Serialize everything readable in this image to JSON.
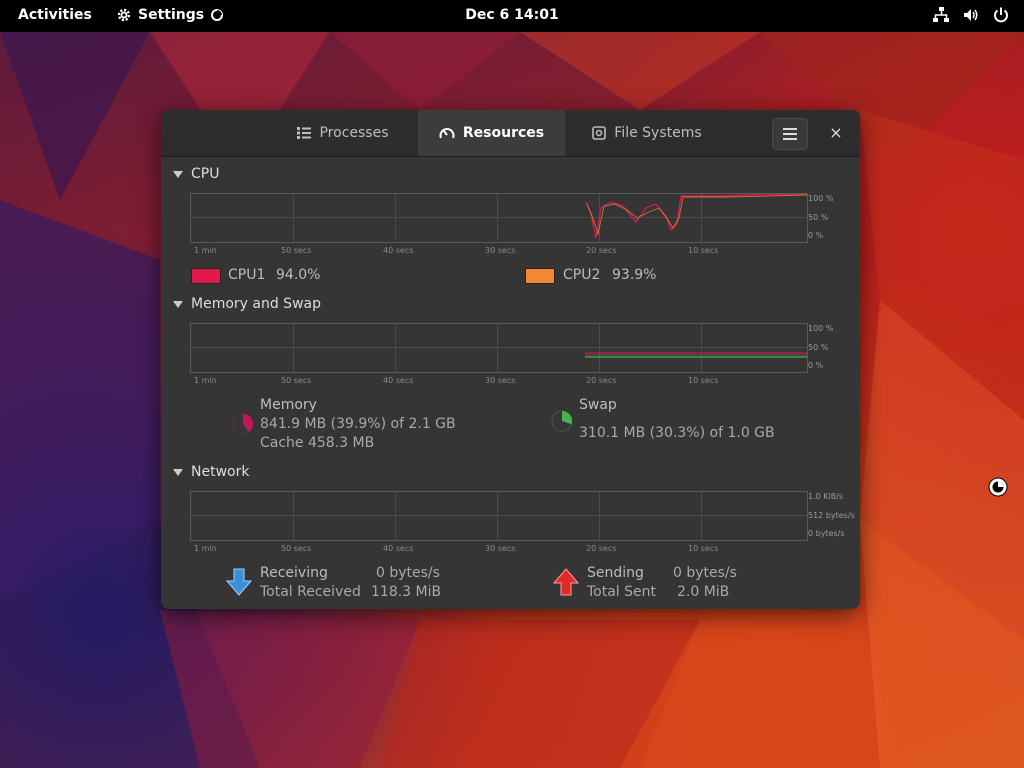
{
  "topbar": {
    "activities": "Activities",
    "app_name": "Settings",
    "clock": "Dec 6  14:01"
  },
  "window": {
    "tabs": [
      {
        "label": "Processes",
        "icon": "list-icon"
      },
      {
        "label": "Resources",
        "icon": "gauge-icon"
      },
      {
        "label": "File Systems",
        "icon": "disk-icon"
      }
    ],
    "active_tab": "Resources",
    "close_glyph": "×"
  },
  "cpu": {
    "title": "CPU",
    "y_ticks": [
      "100 %",
      "50 %",
      "0 %"
    ],
    "x_ticks": [
      "1 min",
      "50 secs",
      "40 secs",
      "30 secs",
      "20 secs",
      "10 secs"
    ],
    "cpus": [
      {
        "name": "CPU1",
        "value": "94.0%",
        "color": "#e01b4c"
      },
      {
        "name": "CPU2",
        "value": "93.9%",
        "color": "#f58632"
      }
    ]
  },
  "memory": {
    "title": "Memory and Swap",
    "y_ticks": [
      "100 %",
      "50 %",
      "0 %"
    ],
    "x_ticks": [
      "1 min",
      "50 secs",
      "40 secs",
      "30 secs",
      "20 secs",
      "10 secs"
    ],
    "memory_label": "Memory",
    "memory_used": "841.9 MB (39.9%) of 2.1 GB",
    "memory_cache": "Cache 458.3 MB",
    "memory_color": "#c2185b",
    "memory_fraction": 0.399,
    "swap_label": "Swap",
    "swap_used": "310.1 MB (30.3%) of 1.0 GB",
    "swap_color": "#4caf50",
    "swap_fraction": 0.303
  },
  "network": {
    "title": "Network",
    "y_ticks": [
      "1.0 KiB/s",
      "512 bytes/s",
      "0 bytes/s"
    ],
    "x_ticks": [
      "1 min",
      "50 secs",
      "40 secs",
      "30 secs",
      "20 secs",
      "10 secs"
    ],
    "receiving_label": "Receiving",
    "receiving_value": "0 bytes/s",
    "total_received_label": "Total Received",
    "total_received_value": "118.3 MiB",
    "sending_label": "Sending",
    "sending_value": "0 bytes/s",
    "total_sent_label": "Total Sent",
    "total_sent_value": "2.0 MiB",
    "receive_color": "#3a8fd6",
    "send_color": "#e02a2a"
  }
}
